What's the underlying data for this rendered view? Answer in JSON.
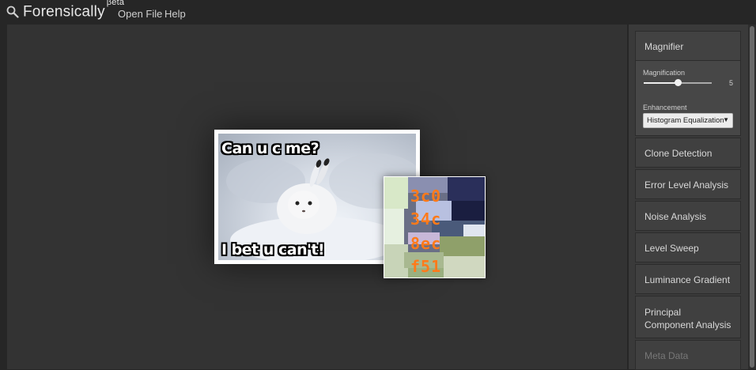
{
  "app": {
    "title": "Forensically",
    "superscript": "βeta"
  },
  "menu": {
    "open_file": "Open File",
    "help": "Help"
  },
  "image": {
    "top_caption": "Can u c me?",
    "bottom_caption": "I bet u can't!"
  },
  "magnifier_view": {
    "lines": [
      "3c0",
      "34c",
      "8ec",
      "f51"
    ]
  },
  "tools": {
    "magnifier": {
      "title": "Magnifier",
      "magnification_label": "Magnification",
      "magnification_value": "5",
      "magnification_fraction": 0.5,
      "enhancement_label": "Enhancement",
      "enhancement_value": "Histogram Equalization"
    },
    "items": [
      "Clone Detection",
      "Error Level Analysis",
      "Noise Analysis",
      "Level Sweep",
      "Luminance Gradient",
      "Principal Component Analysis",
      "Meta Data"
    ]
  },
  "colors": {
    "accent_orange": "#ff7a1a",
    "background": "#262626",
    "canvas": "#333333",
    "panel": "#404040"
  }
}
